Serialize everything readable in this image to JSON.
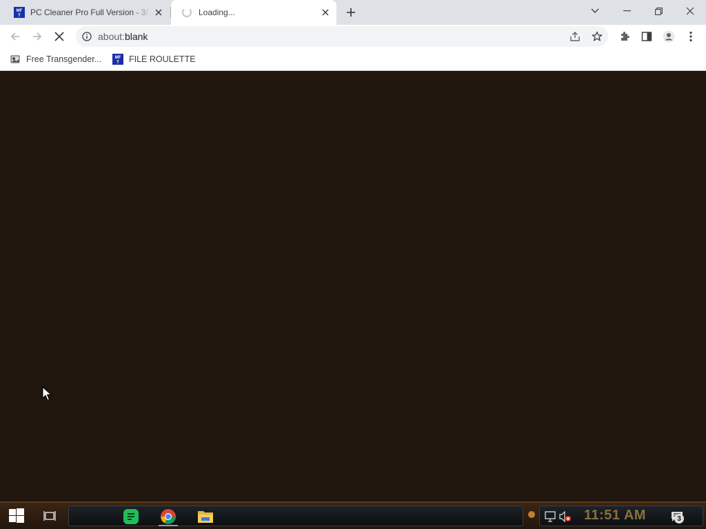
{
  "browser": {
    "tabs": [
      {
        "title": "PC Cleaner Pro Full Version - 3/",
        "favicon": "mft-logo-icon",
        "active": false
      },
      {
        "title": "Loading...",
        "favicon": "loading-spinner-icon",
        "active": true
      }
    ],
    "address": {
      "scheme": "about:",
      "rest": "blank"
    },
    "bookmarks": [
      {
        "label": "Free Transgender...",
        "icon": "webpage-icon"
      },
      {
        "label": "FILE ROULETTE",
        "icon": "mft-logo-icon"
      }
    ]
  },
  "taskbar": {
    "clock": "11:51 AM",
    "notification_count": "3",
    "apps": [
      {
        "name": "chat-app",
        "icon": "chat-icon"
      },
      {
        "name": "chrome",
        "icon": "chrome-icon"
      },
      {
        "name": "file-explorer",
        "icon": "folder-icon"
      }
    ]
  },
  "colors": {
    "page_background": "#20160e",
    "tabstrip": "#dee1e6",
    "clock_text": "#8a6f3e"
  }
}
